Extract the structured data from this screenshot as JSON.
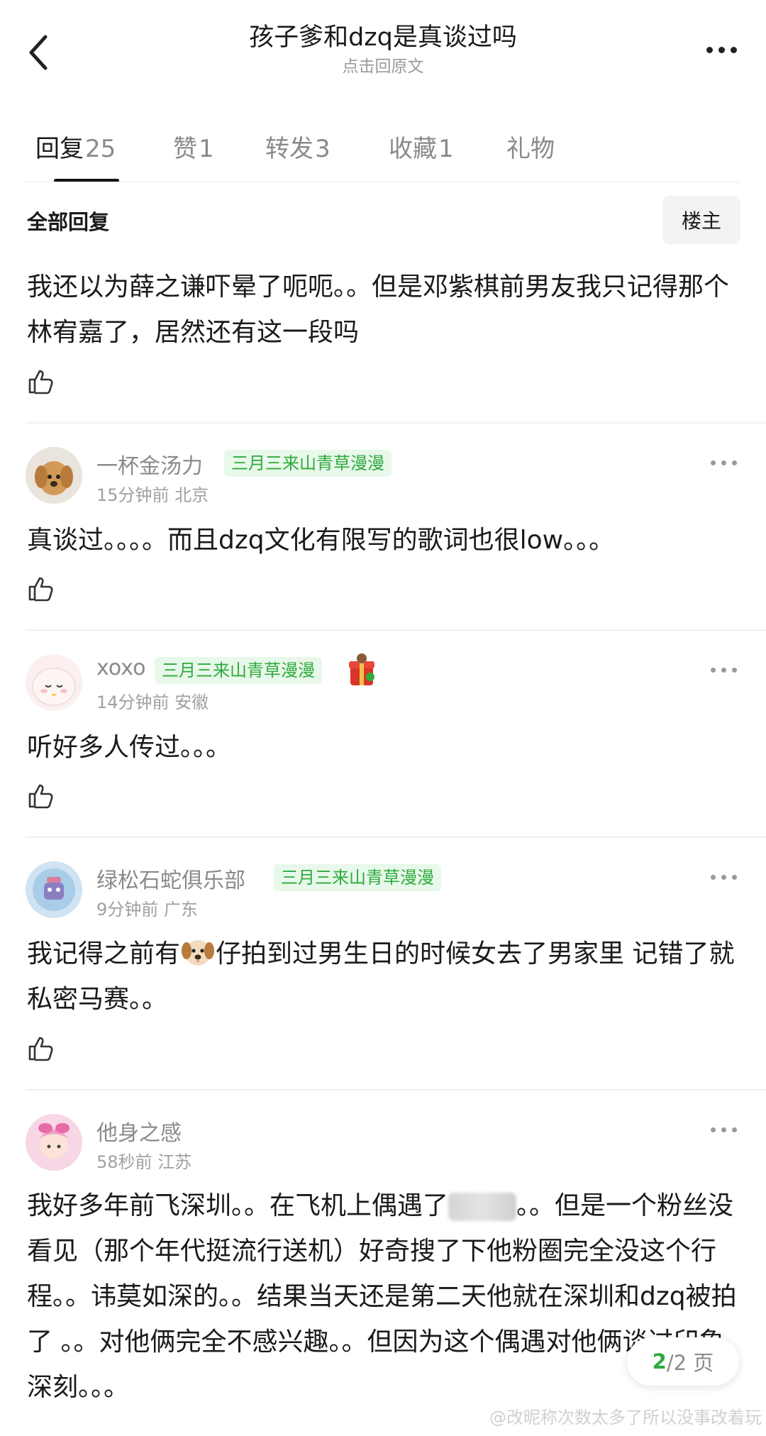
{
  "header": {
    "title": "孩子爹和dzq是真谈过吗",
    "subtitle": "点击回原文"
  },
  "tabs": [
    {
      "label": "回复",
      "count": "25"
    },
    {
      "label": "赞",
      "count": "1"
    },
    {
      "label": "转发",
      "count": "3"
    },
    {
      "label": "收藏",
      "count": "1"
    },
    {
      "label": "礼物",
      "count": ""
    }
  ],
  "filter": {
    "label": "全部回复",
    "owner_button": "楼主"
  },
  "first_reply": {
    "text": "我还以为薛之谦吓晕了呃呃。。但是邓紫棋前男友我只记得那个林宥嘉了，居然还有这一段吗"
  },
  "comments": [
    {
      "name": "一杯金汤力",
      "badge": "三月三来山青草漫漫",
      "time": "15分钟前",
      "location": "北京",
      "text": "真谈过。。。。而且dzq文化有限写的歌词也很low。。。"
    },
    {
      "name": "xoxo",
      "badge": "三月三来山青草漫漫",
      "time": "14分钟前",
      "location": "安徽",
      "text": "听好多人传过。。。"
    },
    {
      "name": "绿松石蛇俱乐部",
      "badge": "三月三来山青草漫漫",
      "time": "9分钟前",
      "location": "广东",
      "text_before": "我记得之前有",
      "text_after": "仔拍到过男生日的时候女去了男家里 记错了就私密马赛。。"
    },
    {
      "name": "他身之感",
      "badge": "",
      "time": "58秒前",
      "location": "江苏",
      "text_before": "我好多年前飞深圳。。在飞机上偶遇了",
      "text_after": "。。但是一个粉丝没看见（那个年代挺流行送机）好奇搜了下他粉圈完全没这个行程。。讳莫如深的。。结果当天还是第二天他就在深圳和dzq被拍了 。。对他俩完全不感兴趣。。但因为这个偶遇对他俩谈过印象深刻。。。"
    }
  ],
  "pager": {
    "current": "2",
    "total": "/2 页"
  },
  "watermark": "@改昵称次数太多了所以没事改着玩",
  "icons": {
    "back": "chevron-left-icon",
    "more": "more-dots-icon",
    "like": "thumbs-up-icon"
  }
}
